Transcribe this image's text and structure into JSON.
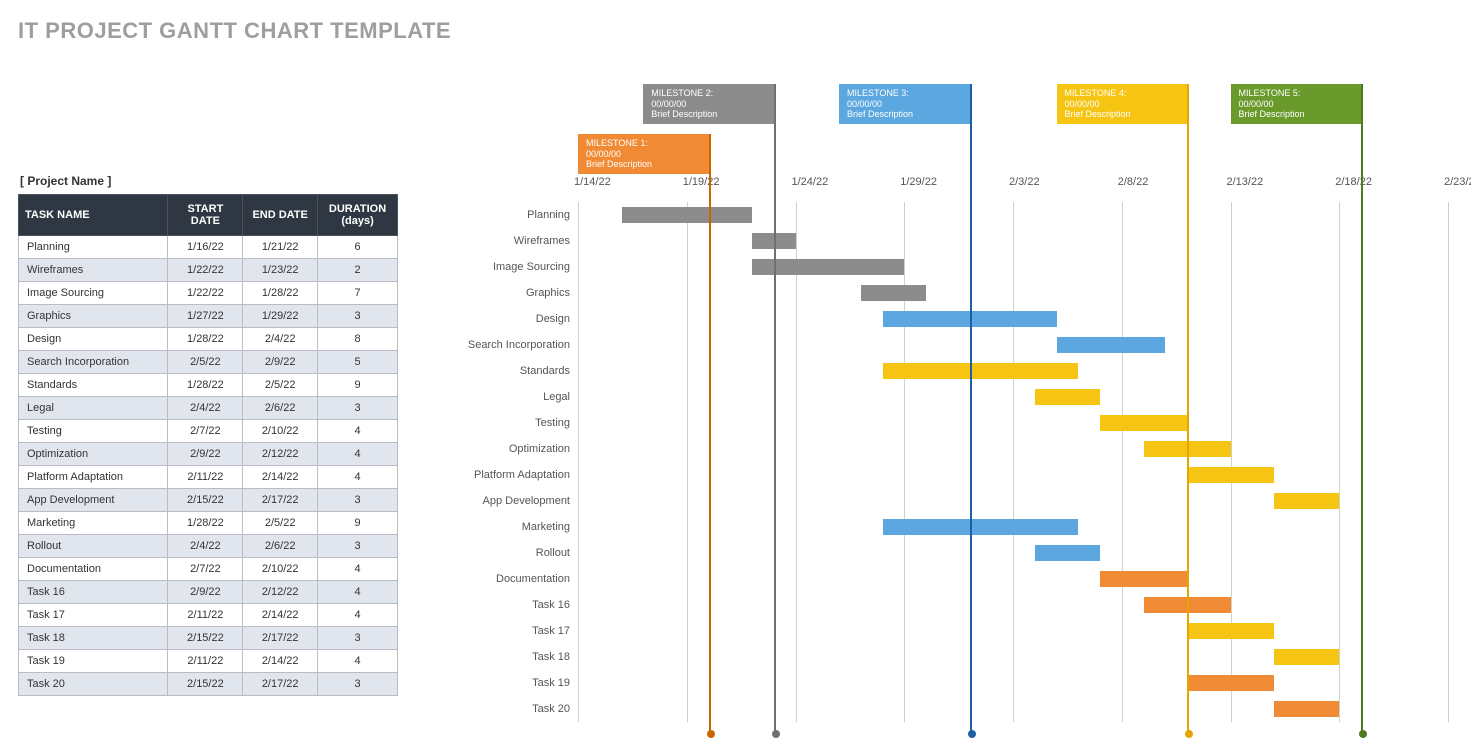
{
  "title": "IT PROJECT GANTT CHART TEMPLATE",
  "project_name_label": "[ Project Name ]",
  "table_headers": {
    "name": "TASK NAME",
    "start": "START DATE",
    "end": "END DATE",
    "duration": "DURATION (days)"
  },
  "chart_data": {
    "type": "bar",
    "orientation": "horizontal-gantt",
    "x_axis_dates": [
      "1/14/22",
      "1/19/22",
      "1/24/22",
      "1/29/22",
      "2/3/22",
      "2/8/22",
      "2/13/22",
      "2/18/22",
      "2/23/22"
    ],
    "x_axis_serial": [
      44575,
      44580,
      44585,
      44590,
      44595,
      44600,
      44605,
      44610,
      44615
    ],
    "x_range": [
      44575,
      44615
    ],
    "colors": {
      "gray": "#8c8c8c",
      "blue": "#5ca7e0",
      "yellow": "#f6c413",
      "orange": "#f08a34",
      "green": "#6a9a2b",
      "dark_blue": "#1f5fa8",
      "dark_orange": "#cc6500",
      "dark_yellow": "#e5a600",
      "dark_green": "#4e7a1f",
      "dark_gray": "#707070"
    },
    "tasks": [
      {
        "name": "Planning",
        "start": "1/16/22",
        "end": "1/21/22",
        "duration": 6,
        "start_s": 44577,
        "color": "gray"
      },
      {
        "name": "Wireframes",
        "start": "1/22/22",
        "end": "1/23/22",
        "duration": 2,
        "start_s": 44583,
        "color": "gray"
      },
      {
        "name": "Image Sourcing",
        "start": "1/22/22",
        "end": "1/28/22",
        "duration": 7,
        "start_s": 44583,
        "color": "gray"
      },
      {
        "name": "Graphics",
        "start": "1/27/22",
        "end": "1/29/22",
        "duration": 3,
        "start_s": 44588,
        "color": "gray"
      },
      {
        "name": "Design",
        "start": "1/28/22",
        "end": "2/4/22",
        "duration": 8,
        "start_s": 44589,
        "color": "blue"
      },
      {
        "name": "Search Incorporation",
        "start": "2/5/22",
        "end": "2/9/22",
        "duration": 5,
        "start_s": 44597,
        "color": "blue"
      },
      {
        "name": "Standards",
        "start": "1/28/22",
        "end": "2/5/22",
        "duration": 9,
        "start_s": 44589,
        "color": "yellow"
      },
      {
        "name": "Legal",
        "start": "2/4/22",
        "end": "2/6/22",
        "duration": 3,
        "start_s": 44596,
        "color": "yellow"
      },
      {
        "name": "Testing",
        "start": "2/7/22",
        "end": "2/10/22",
        "duration": 4,
        "start_s": 44599,
        "color": "yellow"
      },
      {
        "name": "Optimization",
        "start": "2/9/22",
        "end": "2/12/22",
        "duration": 4,
        "start_s": 44601,
        "color": "yellow"
      },
      {
        "name": "Platform Adaptation",
        "start": "2/11/22",
        "end": "2/14/22",
        "duration": 4,
        "start_s": 44603,
        "color": "yellow"
      },
      {
        "name": "App Development",
        "start": "2/15/22",
        "end": "2/17/22",
        "duration": 3,
        "start_s": 44607,
        "color": "yellow"
      },
      {
        "name": "Marketing",
        "start": "1/28/22",
        "end": "2/5/22",
        "duration": 9,
        "start_s": 44589,
        "color": "blue"
      },
      {
        "name": "Rollout",
        "start": "2/4/22",
        "end": "2/6/22",
        "duration": 3,
        "start_s": 44596,
        "color": "blue"
      },
      {
        "name": "Documentation",
        "start": "2/7/22",
        "end": "2/10/22",
        "duration": 4,
        "start_s": 44599,
        "color": "orange"
      },
      {
        "name": "Task 16",
        "start": "2/9/22",
        "end": "2/12/22",
        "duration": 4,
        "start_s": 44601,
        "color": "orange"
      },
      {
        "name": "Task 17",
        "start": "2/11/22",
        "end": "2/14/22",
        "duration": 4,
        "start_s": 44603,
        "color": "yellow"
      },
      {
        "name": "Task 18",
        "start": "2/15/22",
        "end": "2/17/22",
        "duration": 3,
        "start_s": 44607,
        "color": "yellow"
      },
      {
        "name": "Task 19",
        "start": "2/11/22",
        "end": "2/14/22",
        "duration": 4,
        "start_s": 44603,
        "color": "orange"
      },
      {
        "name": "Task 20",
        "start": "2/15/22",
        "end": "2/17/22",
        "duration": 3,
        "start_s": 44607,
        "color": "orange"
      }
    ],
    "milestones": [
      {
        "label": "MILESTONE 1:\n00/00/00\nBrief Description",
        "pos": 44581,
        "left_s": 44575,
        "color": "orange",
        "line": "dark_orange",
        "row": 1
      },
      {
        "label": "MILESTONE 2:\n00/00/00\nBrief Description",
        "pos": 44584,
        "left_s": 44578,
        "color": "gray",
        "line": "dark_gray",
        "row": 0
      },
      {
        "label": "MILESTONE 3:\n00/00/00\nBrief Description",
        "pos": 44593,
        "left_s": 44587,
        "color": "blue",
        "line": "dark_blue",
        "row": 0
      },
      {
        "label": "MILESTONE 4:\n00/00/00\nBrief Description",
        "pos": 44603,
        "left_s": 44597,
        "color": "yellow",
        "line": "dark_yellow",
        "row": 0
      },
      {
        "label": "MILESTONE 5:\n00/00/00\nBrief Description",
        "pos": 44611,
        "left_s": 44605,
        "color": "green",
        "line": "dark_green",
        "row": 0
      }
    ]
  }
}
